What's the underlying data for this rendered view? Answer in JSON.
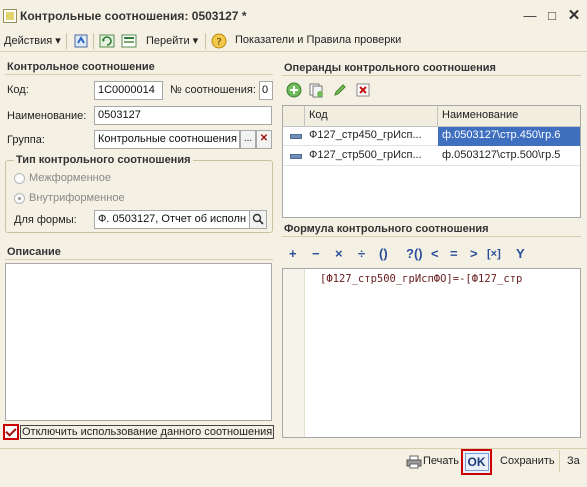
{
  "window": {
    "title": "Контрольные соотношения: 0503127 *",
    "minimize_symbol": "—",
    "maximize_symbol": "□",
    "close_symbol": "✕"
  },
  "toolbar": {
    "actions_label": "Действия",
    "goto_label": "Перейти",
    "rules_label": "Показатели и Правила проверки",
    "dropdown_symbol": "▾",
    "help_symbol": "?"
  },
  "relation": {
    "section_title": "Контрольное соотношение",
    "code_label": "Код:",
    "code_value": "1С0000014",
    "number_label": "№ соотношения:",
    "number_value": "0",
    "name_label": "Наименование:",
    "name_value": "0503127",
    "group_label": "Группа:",
    "group_value": "Контрольные соотношения",
    "group_select_symbol": "...",
    "group_clear_symbol": "✕"
  },
  "type_group": {
    "title": "Тип контрольного соотношения",
    "option_inter": "Межформенное",
    "option_intra": "Внутриформенное",
    "form_label": "Для формы:",
    "form_value": "Ф. 0503127, Отчет об исполн"
  },
  "description": {
    "title": "Описание",
    "value": ""
  },
  "disable_relation": {
    "label": "Отключить использование данного соотношения",
    "checked": true
  },
  "operands": {
    "title": "Операнды контрольного соотношения",
    "columns": [
      "Код",
      "Наименование"
    ],
    "rows": [
      {
        "code": "Ф127_стр450_грИсп...",
        "name": "ф.0503127\\стр.450\\гр.6"
      },
      {
        "code": "Ф127_стр500_грИсп...",
        "name": "ф.0503127\\стр.500\\гр.5"
      }
    ]
  },
  "formula": {
    "title": "Формула контрольного соотношения",
    "buttons": [
      "+",
      "−",
      "×",
      "÷",
      "()",
      "?()",
      "<",
      "=",
      ">",
      "[×]",
      "Y"
    ],
    "text": "[Ф127_стр500_грИспФО]=-[Ф127_стр"
  },
  "footer": {
    "print_label": "Печать",
    "ok_label": "OK",
    "save_label": "Сохранить",
    "close_label": "За"
  },
  "colors": {
    "background": "#f4f1e4",
    "accent_red": "#cc0000",
    "selection_blue": "#3f6fbf"
  }
}
